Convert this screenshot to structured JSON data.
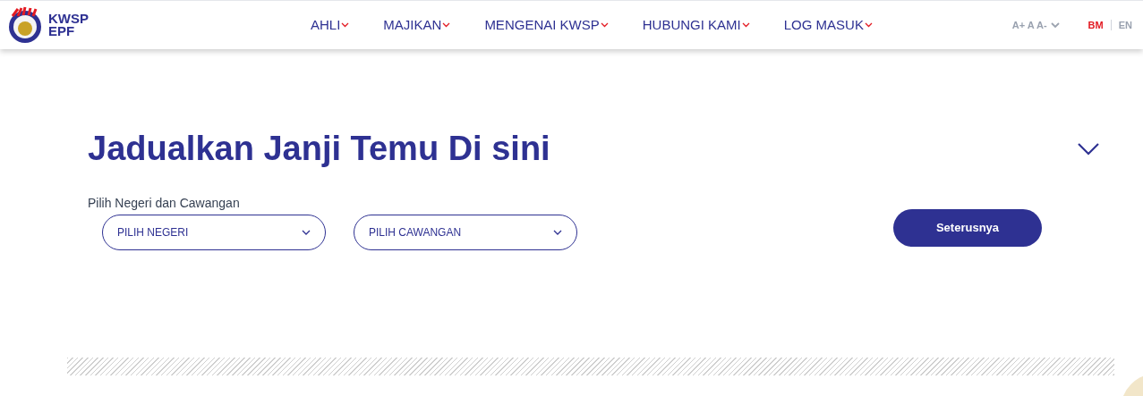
{
  "logo": {
    "lines": [
      "KWSP",
      "EPF"
    ]
  },
  "nav": [
    {
      "label": "AHLI"
    },
    {
      "label": "MAJIKAN"
    },
    {
      "label": "MENGENAI KWSP"
    },
    {
      "label": "HUBUNGI KAMI"
    },
    {
      "label": "LOG MASUK"
    }
  ],
  "font_size": {
    "label": "A+ A A-"
  },
  "languages": [
    {
      "label": "BM",
      "selected": true
    },
    {
      "label": "EN",
      "selected": false
    }
  ],
  "section": {
    "title": "Jadualkan Janji Temu Di sini",
    "field_label": "Pilih Negeri dan Cawangan",
    "selects": [
      {
        "value": "PILIH NEGERI"
      },
      {
        "value": "PILIH CAWANGAN"
      }
    ],
    "button": "Seterusnya"
  }
}
